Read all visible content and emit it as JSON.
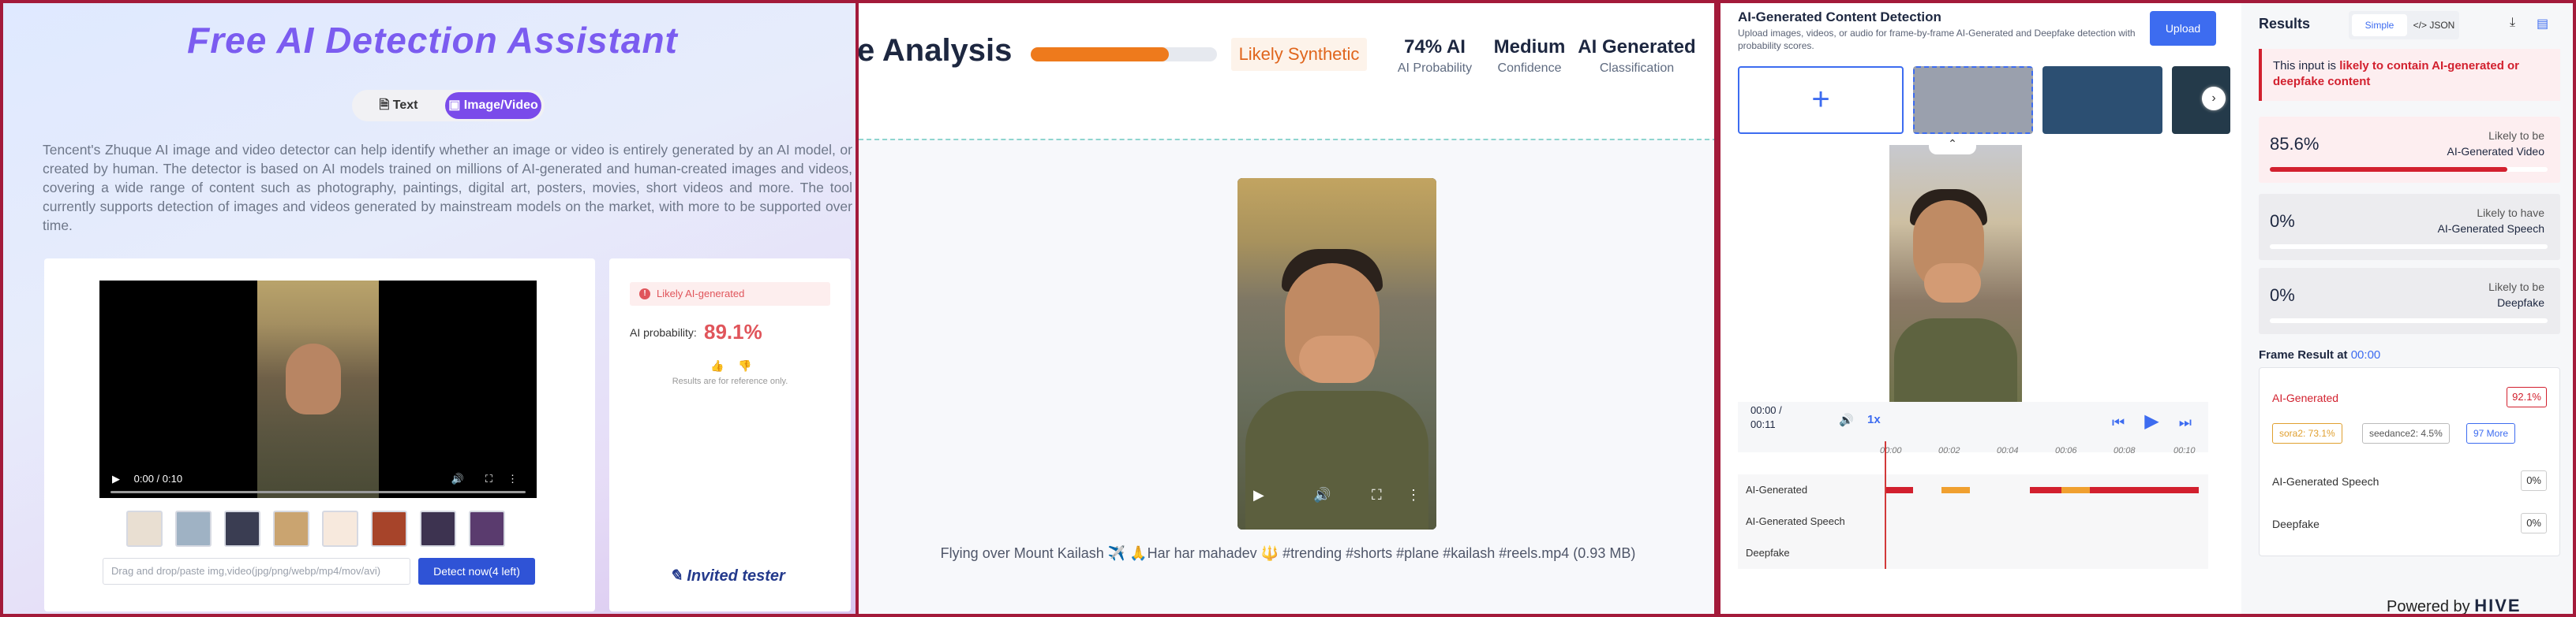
{
  "panel1": {
    "title": "Free AI Detection Assistant",
    "tabs": [
      {
        "label": "Text"
      },
      {
        "label": "Image/Video"
      }
    ],
    "active_tab": "Image/Video",
    "description": "Tencent's Zhuque AI image and video detector can help identify whether an image or video is entirely generated by an AI model, or created by human. The detector is based on AI models trained on millions of AI-generated and human-created images and videos, covering a wide range of content such as photography, paintings, digital art, posters, movies, short videos and more. The tool currently supports detection of images and videos generated by mainstream models on the market, with more to be supported over time.",
    "video_time": "0:00 / 0:10",
    "dropzone_placeholder": "Drag and drop/paste img,video(jpg/png/webp/mp4/mov/avi)",
    "detect_button": "Detect now(4 left)",
    "result_badge": "Likely AI-generated",
    "ai_probability_label": "AI probability:",
    "ai_probability_value": "89.1%",
    "ai_probability_fraction": 0.891,
    "reference_note": "Results are for reference only.",
    "invited": "Invited tester",
    "thumb_colors": [
      "#e9dfd2",
      "#9fb2c4",
      "#3a3d52",
      "#caa470",
      "#f7e9dd",
      "#a7442a",
      "#3d3350",
      "#5a3b6e"
    ],
    "accent": "#7a4bea"
  },
  "panel2": {
    "title_fragment": "e Analysis",
    "progress_fraction": 0.74,
    "verdict": "Likely Synthetic",
    "stats": [
      {
        "big": "74% AI",
        "small": "AI Probability"
      },
      {
        "big": "Medium",
        "small": "Confidence"
      },
      {
        "big": "AI Generated",
        "small": "Classification"
      }
    ],
    "caption": "Flying over Mount Kailash ✈️ 🙏Har har mahadev 🔱 #trending #shorts #plane #kailash #reels.mp4 (0.93 MB)",
    "accent": "#ee7a1c"
  },
  "panel3": {
    "title": "AI-Generated Content Detection",
    "subtitle": "Upload images, videos, or audio for frame-by-frame AI-Generated and Deepfake detection with probability scores.",
    "upload_button": "Upload",
    "gallery_colors": [
      "#9aa0ad",
      "#2c4f72",
      "#243a4a"
    ],
    "time": "00:00 / 00:11",
    "speed": "1x",
    "ruler_ticks": [
      "00:00",
      "00:02",
      "00:04",
      "00:06",
      "00:08",
      "00:10"
    ],
    "tracks": [
      "AI-Generated",
      "AI-Generated Speech",
      "Deepfake"
    ],
    "results_title": "Results",
    "view_toggle": {
      "simple": "Simple",
      "json": "</> JSON"
    },
    "alert_prefix": "This input is ",
    "alert_bold": "likely to contain AI-generated or deepfake content",
    "result_cards": [
      {
        "pct": "85.6%",
        "line1": "Likely to be",
        "line2": "AI-Generated Video",
        "fraction": 0.856
      },
      {
        "pct": "0%",
        "line1": "Likely to have",
        "line2": "AI-Generated Speech",
        "fraction": 0
      },
      {
        "pct": "0%",
        "line1": "Likely to be",
        "line2": "Deepfake",
        "fraction": 0
      }
    ],
    "frame_result_label": "Frame Result at",
    "frame_result_time": "00:00",
    "frame_rows": [
      {
        "label": "AI-Generated",
        "value": "92.1%"
      },
      {
        "label": "AI-Generated Speech",
        "value": "0%"
      },
      {
        "label": "Deepfake",
        "value": "0%"
      }
    ],
    "chips": [
      {
        "label": "sora2: 73.1%",
        "color": "#e0a030"
      },
      {
        "label": "seedance2: 4.5%",
        "color": "#555555"
      },
      {
        "label": "97 More",
        "color": "#3d6cf0"
      }
    ],
    "powered_by": "Powered by",
    "brand": "HIVE",
    "accent": "#d2202e"
  }
}
